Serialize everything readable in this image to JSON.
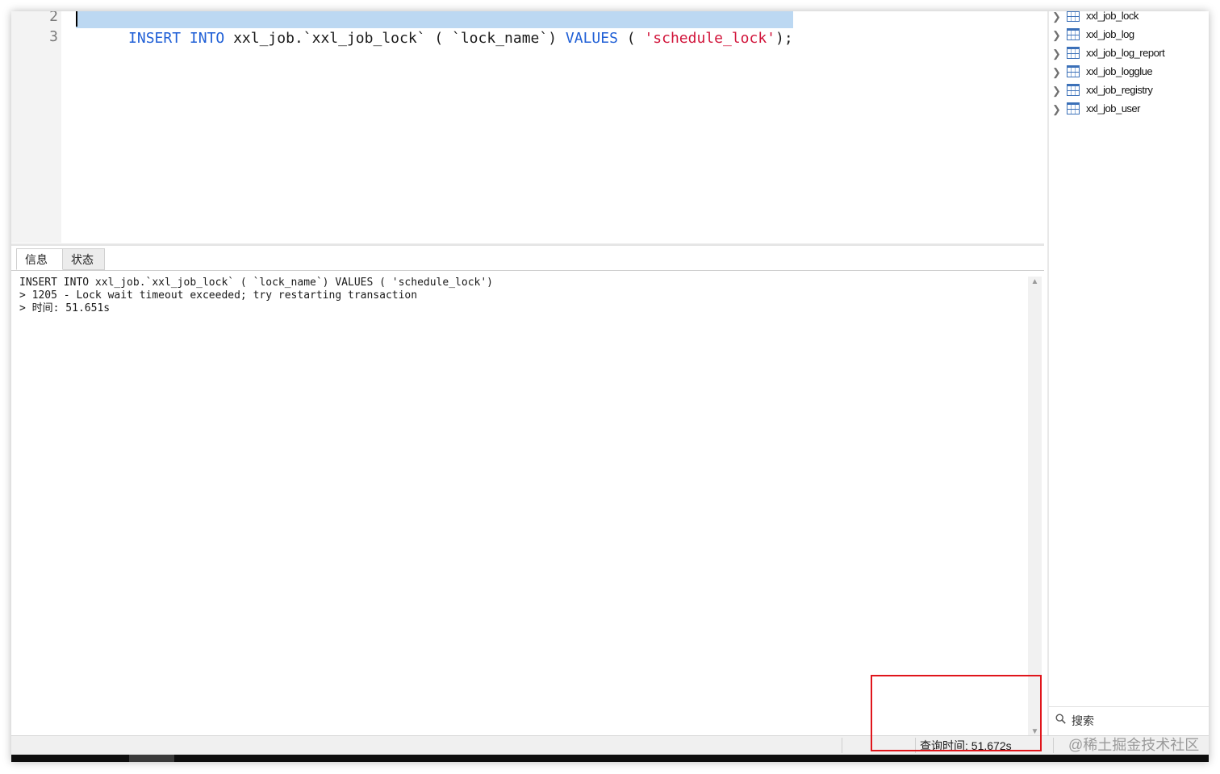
{
  "editor": {
    "line_numbers": [
      "2",
      "3"
    ],
    "code_tokens": [
      {
        "text": "INSERT INTO",
        "kind": "kw"
      },
      {
        "text": " xxl_job.`xxl_job_lock` ( `lock_name`) ",
        "kind": "plain"
      },
      {
        "text": "VALUES",
        "kind": "kw"
      },
      {
        "text": " ( ",
        "kind": "plain"
      },
      {
        "text": "'schedule_lock'",
        "kind": "str"
      },
      {
        "text": ");",
        "kind": "plain"
      }
    ]
  },
  "result": {
    "tabs": [
      "信息",
      "状态"
    ],
    "log_lines": [
      "INSERT INTO xxl_job.`xxl_job_lock` ( `lock_name`) VALUES ( 'schedule_lock')",
      "> 1205 - Lock wait timeout exceeded; try restarting transaction",
      "> 时间: 51.651s"
    ]
  },
  "status_bar": {
    "query_time": "查询时间: 51.672s",
    "watermark": "@稀土掘金技术社区"
  },
  "tree": {
    "items": [
      "xxl_job_lock",
      "xxl_job_log",
      "xxl_job_log_report",
      "xxl_job_logglue",
      "xxl_job_registry",
      "xxl_job_user"
    ],
    "search_label": "搜索"
  },
  "colors": {
    "keyword": "#1f5fd6",
    "string": "#d1143a",
    "selection": "#bcd8f2",
    "highlight_box": "#e0151b"
  }
}
